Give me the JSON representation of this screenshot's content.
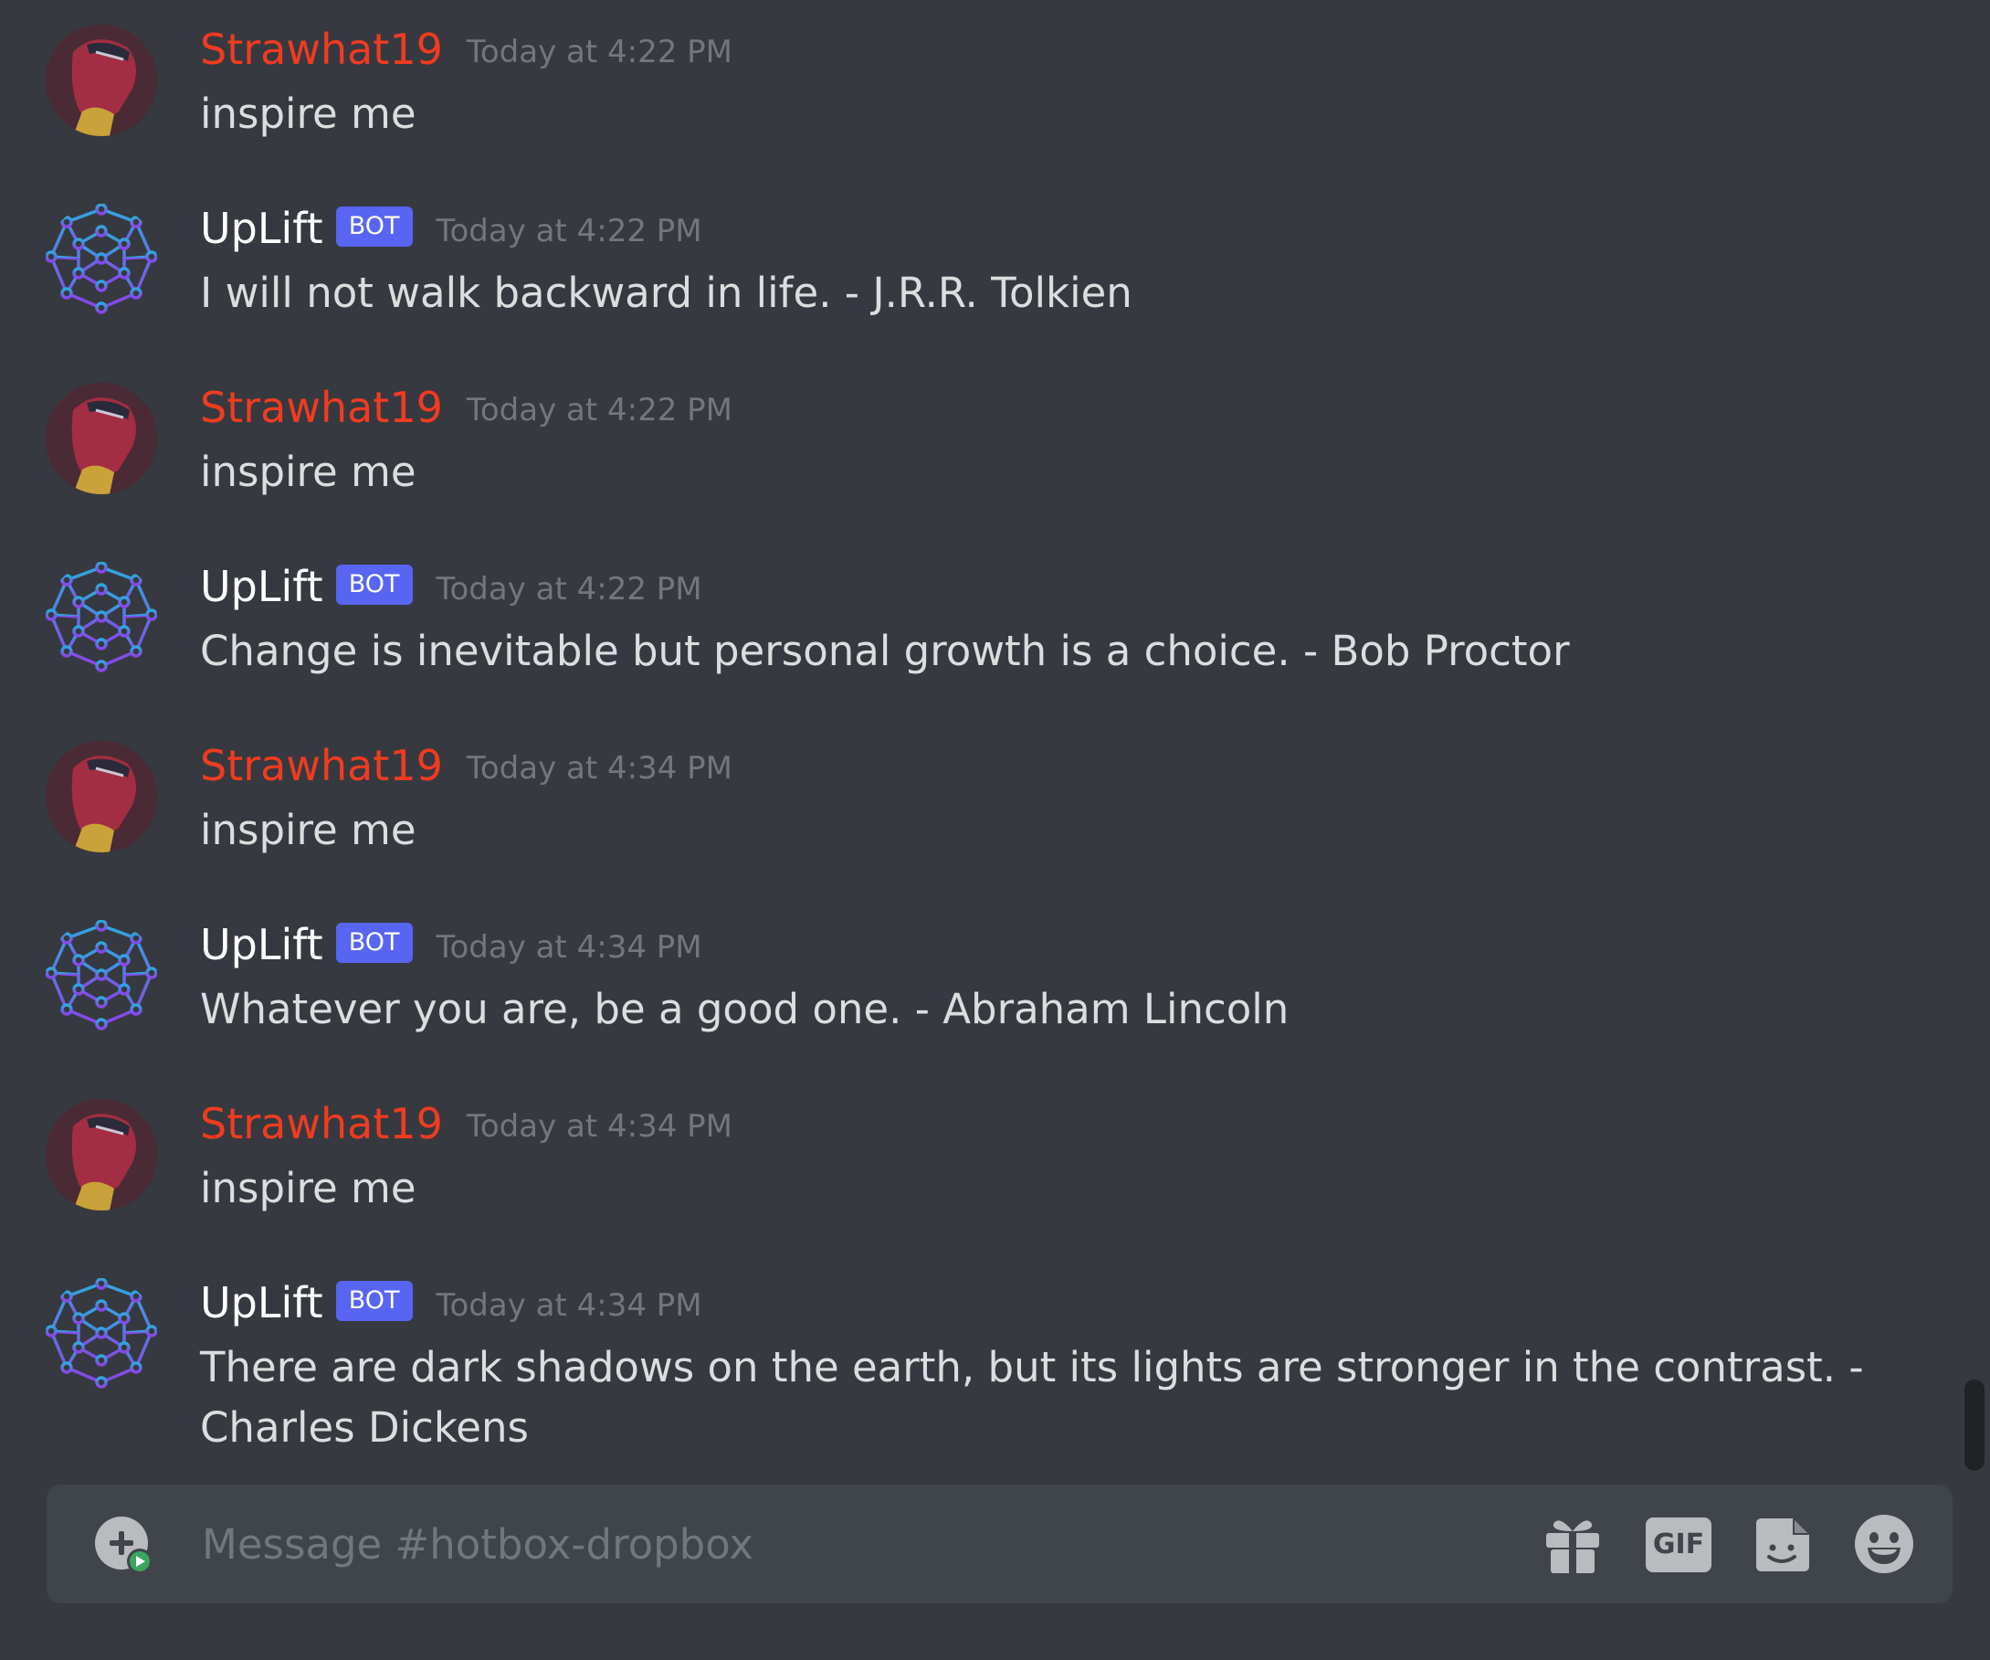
{
  "messages": [
    {
      "author": "Strawhat19",
      "is_bot": false,
      "timestamp": "Today at 4:22 PM",
      "text": "inspire me"
    },
    {
      "author": "UpLift",
      "is_bot": true,
      "badge": "BOT",
      "timestamp": "Today at 4:22 PM",
      "text": "I will not walk backward in life. - J.R.R. Tolkien"
    },
    {
      "author": "Strawhat19",
      "is_bot": false,
      "timestamp": "Today at 4:22 PM",
      "text": "inspire me"
    },
    {
      "author": "UpLift",
      "is_bot": true,
      "badge": "BOT",
      "timestamp": "Today at 4:22 PM",
      "text": "Change is inevitable but personal growth is a choice. - Bob Proctor"
    },
    {
      "author": "Strawhat19",
      "is_bot": false,
      "timestamp": "Today at 4:34 PM",
      "text": "inspire me"
    },
    {
      "author": "UpLift",
      "is_bot": true,
      "badge": "BOT",
      "timestamp": "Today at 4:34 PM",
      "text": "Whatever you are, be a good one. - Abraham Lincoln"
    },
    {
      "author": "Strawhat19",
      "is_bot": false,
      "timestamp": "Today at 4:34 PM",
      "text": "inspire me"
    },
    {
      "author": "UpLift",
      "is_bot": true,
      "badge": "BOT",
      "timestamp": "Today at 4:34 PM",
      "text": "There are dark shadows on the earth, but its lights are stronger in the contrast. - Charles Dickens"
    }
  ],
  "composer": {
    "placeholder": "Message #hotbox-dropbox",
    "gif_label": "GIF",
    "icons": [
      "add-attachment-icon",
      "gift-icon",
      "gif-icon",
      "sticker-icon",
      "emoji-icon"
    ]
  },
  "colors": {
    "background": "#36393f",
    "composer": "#40444b",
    "user_name": "#f13b20",
    "bot_badge": "#5865f2",
    "timestamp": "#72767d"
  }
}
